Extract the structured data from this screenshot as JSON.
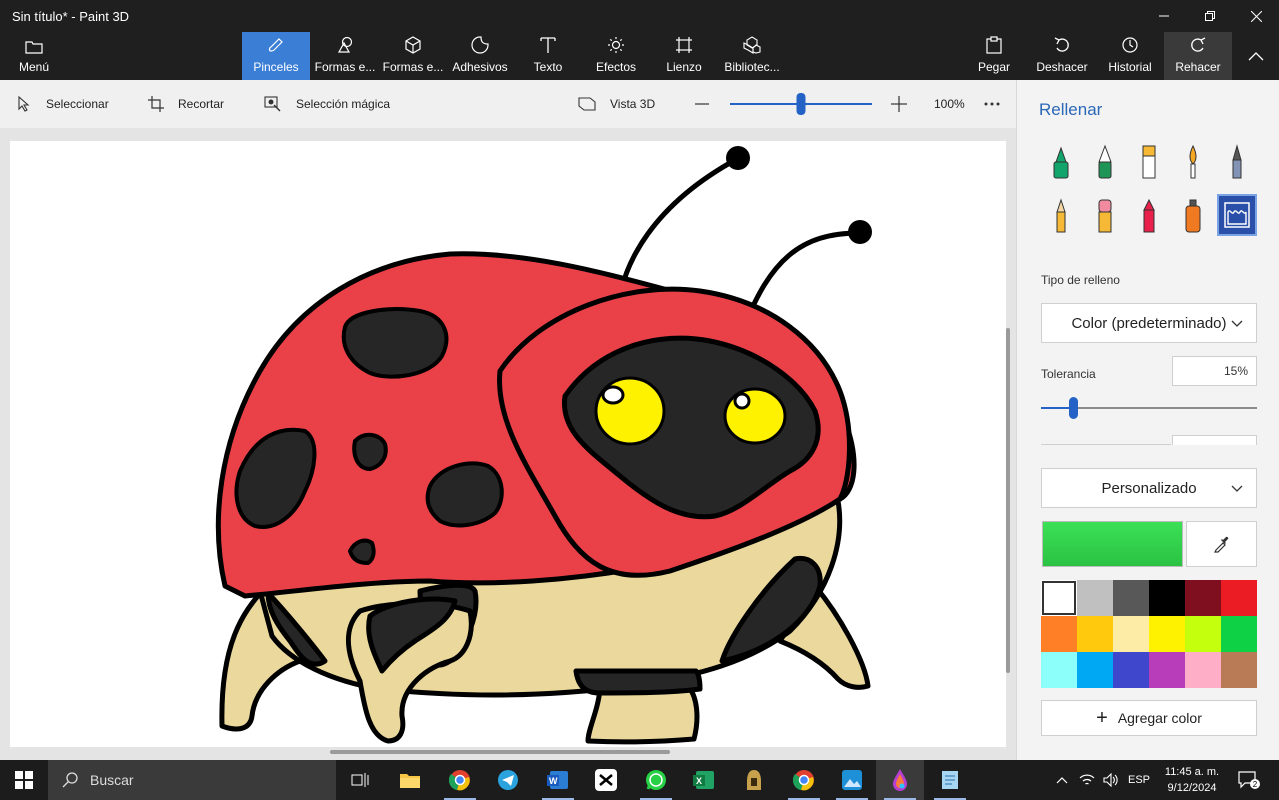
{
  "window": {
    "title": "Sin título* - Paint 3D"
  },
  "ribbon": {
    "menu": "Menú",
    "tools": [
      "Pinceles",
      "Formas e...",
      "Formas e...",
      "Adhesivos",
      "Texto",
      "Efectos",
      "Lienzo",
      "Bibliotec..."
    ],
    "active_tool": "Pinceles",
    "actions": [
      "Pegar",
      "Deshacer",
      "Historial",
      "Rehacer"
    ]
  },
  "toolbar": {
    "select": "Seleccionar",
    "crop": "Recortar",
    "magic_select": "Selección mágica",
    "view3d": "Vista 3D",
    "zoom_level": "100%",
    "zoom_value": 0.5
  },
  "panel": {
    "title": "Rellenar",
    "brushes": [
      "marker-icon",
      "calligraphy-pen-icon",
      "oil-brush-icon",
      "watercolor-icon",
      "pixel-pen-icon",
      "pencil-icon",
      "eraser-icon",
      "crayon-icon",
      "spray-can-icon",
      "fill-bucket-icon"
    ],
    "selected_brush": "fill-bucket-icon",
    "fill_type_label": "Tipo de relleno",
    "fill_type_value": "Color (predeterminado)",
    "tolerance_label": "Tolerancia",
    "tolerance_value": "15%",
    "tolerance": 0.15,
    "color_mode": "Personalizado",
    "current_color": "#2bc244",
    "add_color": "Agregar color",
    "palette": [
      "#ffffff",
      "#c0c0c0",
      "#585858",
      "#000000",
      "#7f0f1e",
      "#ec1c24",
      "#ff7f27",
      "#ffc90e",
      "#fdeca6",
      "#fff200",
      "#c4ff0e",
      "#0ed145",
      "#8cfffb",
      "#00a8f3",
      "#3f48cc",
      "#b83dba",
      "#ffaec8",
      "#b97a56"
    ]
  },
  "taskbar": {
    "search_placeholder": "Buscar",
    "apps": [
      "task-view-icon",
      "file-explorer-icon",
      "chrome-icon",
      "telegram-icon",
      "word-icon",
      "capcut-icon",
      "whatsapp-icon",
      "excel-icon",
      "game-icon",
      "chrome-icon",
      "photos-icon",
      "paint-3d-icon",
      "notepad-icon"
    ],
    "language": "ESP",
    "time": "11:45 a. m.",
    "date": "9/12/2024",
    "notification_count": "2"
  }
}
